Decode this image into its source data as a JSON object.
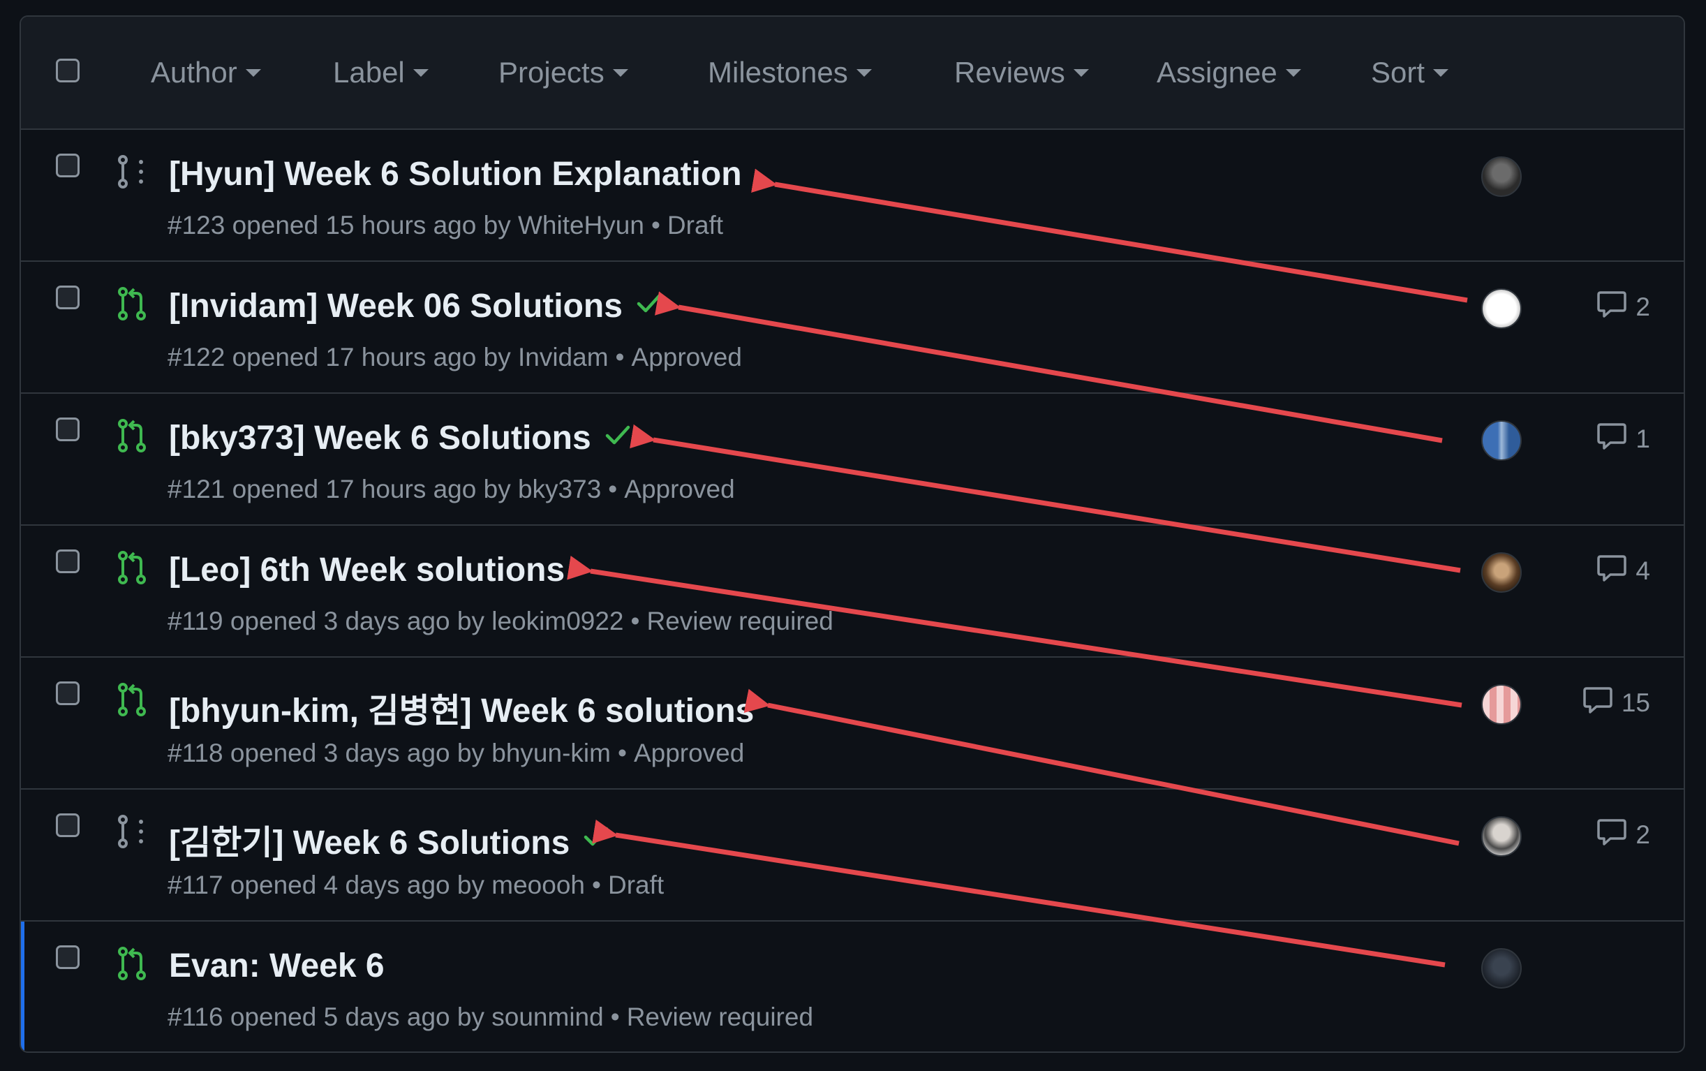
{
  "filters": [
    "Author",
    "Label",
    "Projects",
    "Milestones",
    "Reviews",
    "Assignee",
    "Sort"
  ],
  "colors": {
    "open": "#3fb950",
    "draft": "#8b949e",
    "accent": "#1f6feb",
    "arrow": "#e5484d"
  },
  "rows": [
    {
      "state": "draft",
      "title": "[Hyun] Week 6 Solution Explanation",
      "approved": false,
      "number": "#123",
      "opened": "opened 15 hours ago by",
      "author": "WhiteHyun",
      "status": "Draft",
      "comments": "",
      "avatar": "photo-dark"
    },
    {
      "state": "open",
      "title": "[Invidam] Week 06 Solutions",
      "approved": true,
      "number": "#122",
      "opened": "opened 17 hours ago by",
      "author": "Invidam",
      "status": "Approved",
      "comments": "2",
      "avatar": "cartoon-face"
    },
    {
      "state": "open",
      "title": "[bky373] Week 6 Solutions",
      "approved": true,
      "number": "#121",
      "opened": "opened 17 hours ago by",
      "author": "bky373",
      "status": "Approved",
      "comments": "1",
      "avatar": "photo-blue"
    },
    {
      "state": "open",
      "title": "[Leo] 6th Week solutions",
      "approved": false,
      "number": "#119",
      "opened": "opened 3 days ago by",
      "author": "leokim0922",
      "status": "Review required",
      "comments": "4",
      "avatar": "photo-warm"
    },
    {
      "state": "open",
      "title": "[bhyun-kim, 김병현] Week 6 solutions",
      "approved": false,
      "number": "#118",
      "opened": "opened 3 days ago by",
      "author": "bhyun-kim",
      "status": "Approved",
      "comments": "15",
      "avatar": "identicon-pink"
    },
    {
      "state": "draft",
      "title": "[김한기] Week 6 Solutions",
      "approved": true,
      "number": "#117",
      "opened": "opened 4 days ago by",
      "author": "meoooh",
      "status": "Draft",
      "comments": "2",
      "avatar": "photo-person"
    },
    {
      "state": "open",
      "title": "Evan: Week 6",
      "approved": false,
      "number": "#116",
      "opened": "opened 5 days ago by",
      "author": "sounmind",
      "status": "Review required",
      "comments": "",
      "avatar": "photo-night"
    }
  ]
}
